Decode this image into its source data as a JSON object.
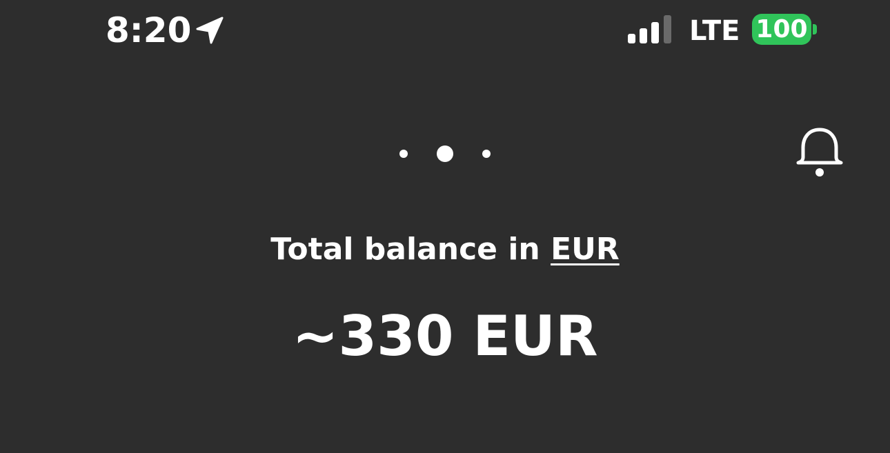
{
  "status_bar": {
    "time": "8:20",
    "location_icon": "location-arrow-icon",
    "signal_icon": "cellular-signal-icon",
    "network": "LTE",
    "battery_level": "100",
    "battery_color": "#30c45a"
  },
  "pager": {
    "total_pages": 3,
    "active_page": 2
  },
  "header": {
    "notifications_icon": "bell-icon"
  },
  "balance": {
    "label_prefix": "Total balance in",
    "currency": "EUR",
    "amount": "~330 EUR"
  },
  "colors": {
    "background": "#2d2d2d",
    "text": "#ffffff",
    "battery": "#30c45a"
  }
}
